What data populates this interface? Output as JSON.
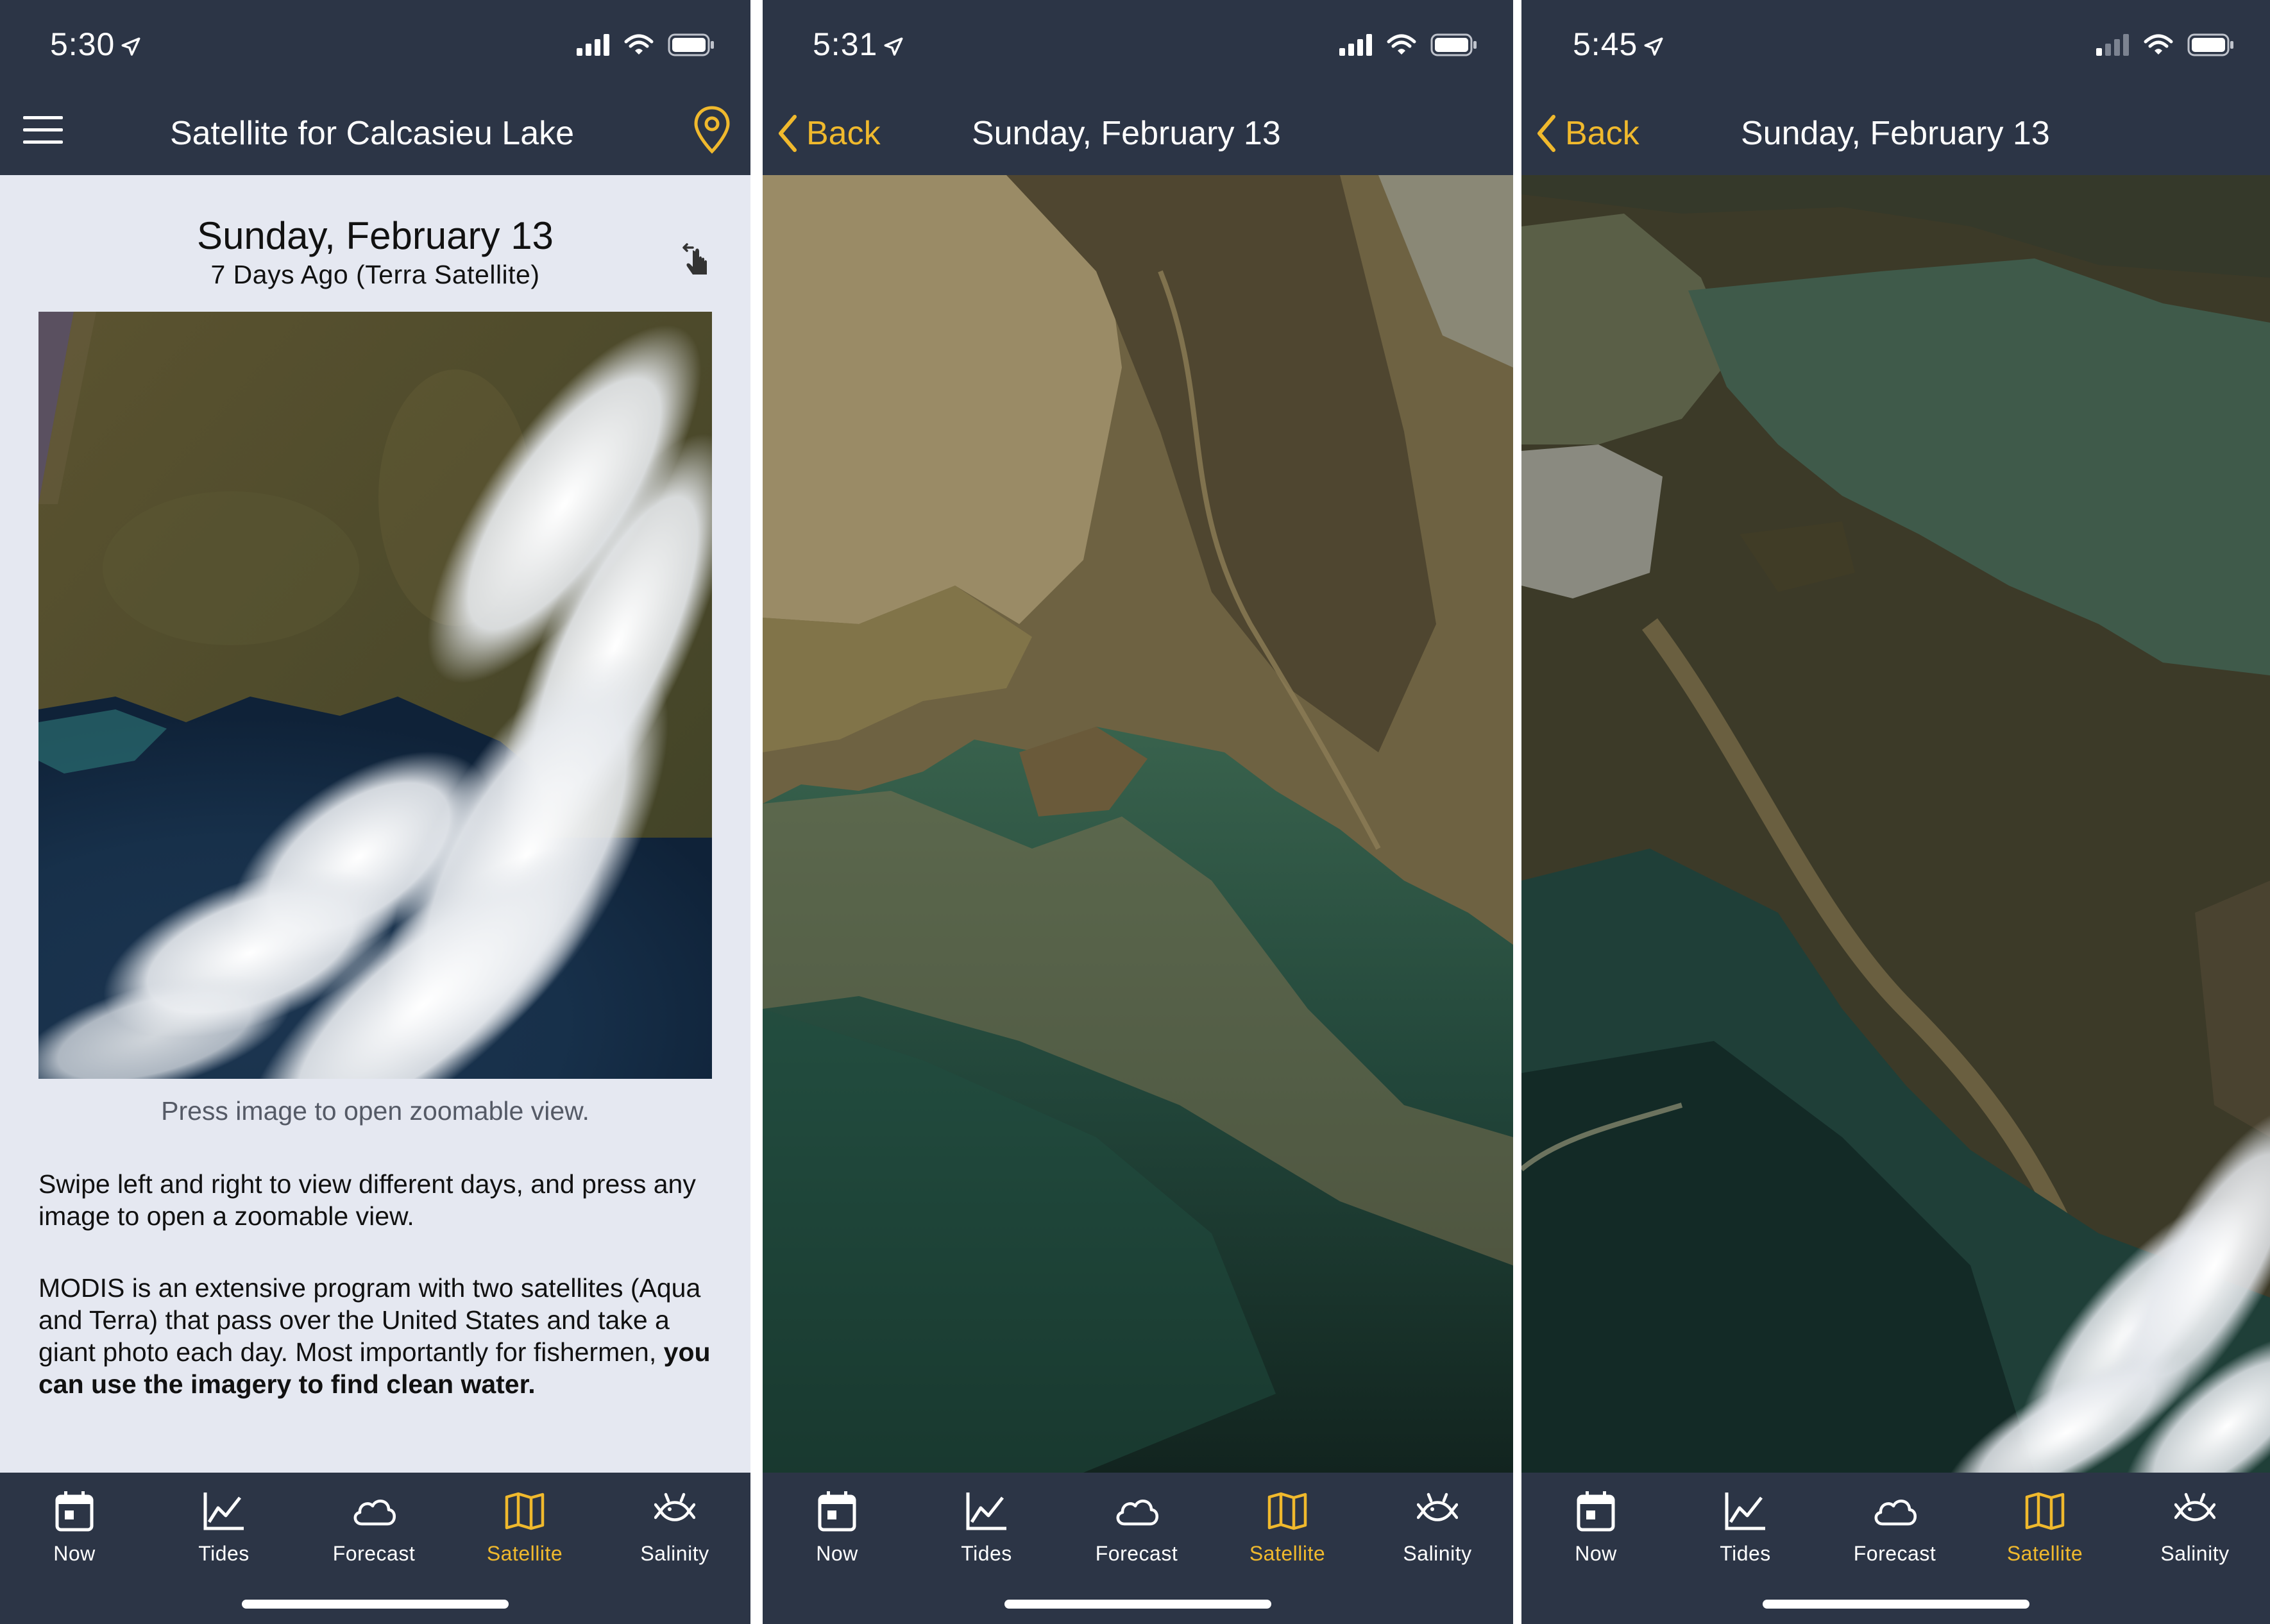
{
  "colors": {
    "accent": "#f0b92d",
    "bar": "#2c3546",
    "content_bg": "#e5e8f1"
  },
  "screens": [
    {
      "time": "5:30",
      "title": "Satellite for Calcasieu Lake",
      "menu_icon": "hamburger-menu-icon",
      "location_icon": "map-pin-icon",
      "date": "Sunday, February 13",
      "subtitle": "7 Days Ago (Terra Satellite)",
      "caption": "Press image to open zoomable view.",
      "para1": "Swipe left and right to view different days, and press any image to open a zoomable view.",
      "para2_plain": "MODIS is an extensive program with two satellites (Aqua and Terra) that pass over the United States and take a giant photo each day. Most importantly for fishermen,",
      "para2_bold": "you can use the imagery to find clean water.",
      "tabs": [
        {
          "label": "Now",
          "icon": "calendar-icon"
        },
        {
          "label": "Tides",
          "icon": "chart-line-icon"
        },
        {
          "label": "Forecast",
          "icon": "cloud-icon"
        },
        {
          "label": "Satellite",
          "icon": "map-icon",
          "active": true
        },
        {
          "label": "Salinity",
          "icon": "fish-icon"
        }
      ]
    },
    {
      "time": "5:31",
      "back": "Back",
      "title": "Sunday, February 13",
      "tabs": [
        {
          "label": "Now",
          "icon": "calendar-icon"
        },
        {
          "label": "Tides",
          "icon": "chart-line-icon"
        },
        {
          "label": "Forecast",
          "icon": "cloud-icon"
        },
        {
          "label": "Satellite",
          "icon": "map-icon",
          "active": true
        },
        {
          "label": "Salinity",
          "icon": "fish-icon"
        }
      ]
    },
    {
      "time": "5:45",
      "back": "Back",
      "title": "Sunday, February 13",
      "tabs": [
        {
          "label": "Now",
          "icon": "calendar-icon"
        },
        {
          "label": "Tides",
          "icon": "chart-line-icon"
        },
        {
          "label": "Forecast",
          "icon": "cloud-icon"
        },
        {
          "label": "Satellite",
          "icon": "map-icon",
          "active": true
        },
        {
          "label": "Salinity",
          "icon": "fish-icon"
        }
      ]
    }
  ]
}
